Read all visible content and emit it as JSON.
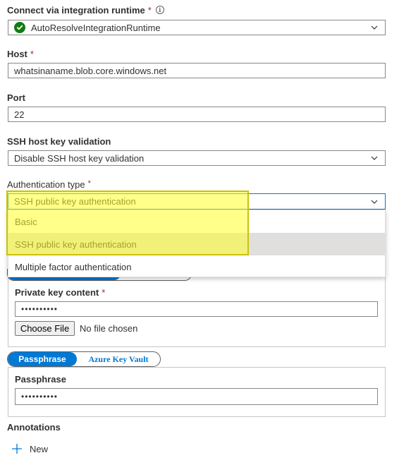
{
  "integration_runtime": {
    "label": "Connect via integration runtime",
    "required": "*",
    "info_icon": "info-icon",
    "value": "AutoResolveIntegrationRuntime",
    "status_icon": "green-check-icon"
  },
  "host": {
    "label": "Host",
    "required": "*",
    "value": "whatsinaname.blob.core.windows.net"
  },
  "port": {
    "label": "Port",
    "value": "22"
  },
  "ssh_host_key": {
    "label": "SSH host key validation",
    "value": "Disable SSH host key validation"
  },
  "auth_type": {
    "label": "Authentication type",
    "required": "*",
    "value": "SSH public key authentication",
    "options": [
      {
        "label": "Basic",
        "selected": false
      },
      {
        "label": "SSH public key authentication",
        "selected": true
      },
      {
        "label": "Multiple factor authentication",
        "selected": false
      }
    ]
  },
  "private_key": {
    "label": "Private key content",
    "required": "*",
    "value": "••••••••••",
    "choose_file_label": "Choose File",
    "no_file_text": "No file chosen"
  },
  "passphrase_toggle": {
    "options": [
      "Passphrase",
      "Azure Key Vault"
    ],
    "selected": "Passphrase"
  },
  "passphrase": {
    "label": "Passphrase",
    "value": "••••••••••"
  },
  "annotations": {
    "label": "Annotations",
    "new_label": "New"
  },
  "colors": {
    "accent": "#0078d4",
    "required": "#a4262c",
    "success": "#107c10",
    "highlight": "#ffff28"
  }
}
